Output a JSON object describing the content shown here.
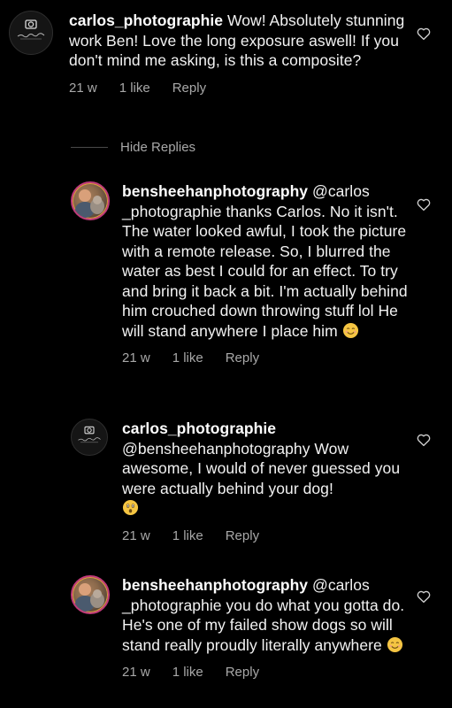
{
  "comments": [
    {
      "username": "carlos_photographie",
      "text": "Wow! Absolutely stunning work Ben! Love the long exposure aswell! If you don't mind me asking, is this a composite?",
      "time": "21 w",
      "likes": "1 like",
      "reply_label": "Reply",
      "avatar_icon": "carlos-photographie-logo"
    },
    {
      "username": "bensheehanphotography",
      "text": "@carlos _photographie thanks Carlos. No it isn't. The water looked awful, I took the picture with a remote release. So, I blurred the water as best I could for an effect. To try and bring it back a bit. I'm actually behind him crouched down throwing stuff lol He will stand anywhere I place him",
      "time": "21 w",
      "likes": "1 like",
      "reply_label": "Reply",
      "trailing_emoji": "smiling-face-emoji"
    },
    {
      "username": "carlos_photographie",
      "text": "@bensheehanphotography Wow awesome, I would of never guessed you were actually behind your dog!",
      "time": "21 w",
      "likes": "1 like",
      "reply_label": "Reply",
      "trailing_emoji": "astonished-face-emoji"
    },
    {
      "username": "bensheehanphotography",
      "text": "@carlos _photographie you do what you gotta do. He's one of my failed show dogs so will stand really proudly literally anywhere",
      "time": "21 w",
      "likes": "1 like",
      "reply_label": "Reply",
      "trailing_emoji": "smiling-face-emoji"
    }
  ],
  "hide_replies_label": "Hide Replies",
  "icons": {
    "like": "heart-outline-icon"
  },
  "colors": {
    "background": "#000000",
    "text": "#f2f2f2",
    "meta": "#a8a8a8",
    "emoji": "#f5c542"
  }
}
